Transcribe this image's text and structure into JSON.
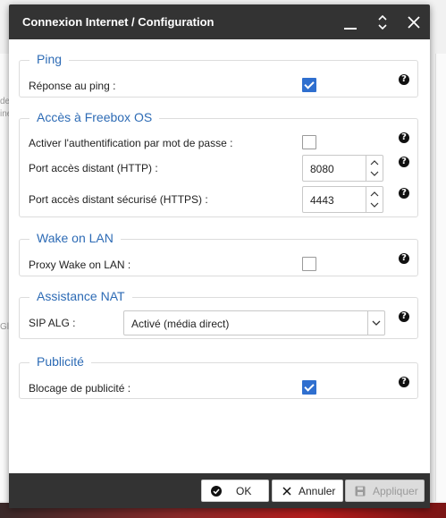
{
  "window": {
    "title": "Connexion Internet / Configuration",
    "minimize_icon": "minimize-icon",
    "maximize_icon": "maximize-icon",
    "close_icon": "close-icon"
  },
  "groups": {
    "ping": {
      "legend": "Ping",
      "rows": [
        {
          "label": "Réponse au ping :",
          "checked": true
        }
      ]
    },
    "freebox_os": {
      "legend": "Accès à Freebox OS",
      "auth_label": "Activer l'authentification par mot de passe :",
      "auth_checked": false,
      "http_label": "Port accès distant (HTTP) :",
      "http_value": "8080",
      "https_label": "Port accès distant sécurisé (HTTPS) :",
      "https_value": "4443"
    },
    "wol": {
      "legend": "Wake on LAN",
      "proxy_label": "Proxy Wake on LAN :",
      "proxy_checked": false
    },
    "nat": {
      "legend": "Assistance NAT",
      "sip_label": "SIP ALG :",
      "sip_value": "Activé (média direct)"
    },
    "pub": {
      "legend": "Publicité",
      "block_label": "Blocage de publicité :",
      "block_checked": true
    }
  },
  "help_glyph": "?",
  "footer": {
    "ok_label": "OK",
    "cancel_label": "Annuler",
    "apply_label": "Appliquer"
  },
  "background_fragments": {
    "left_a": "de",
    "left_b": "ine",
    "left_c": "Gl"
  },
  "colors": {
    "accent": "#2d6bb5",
    "checkbox_on": "#2f6fcf",
    "titlebar": "#333333"
  }
}
